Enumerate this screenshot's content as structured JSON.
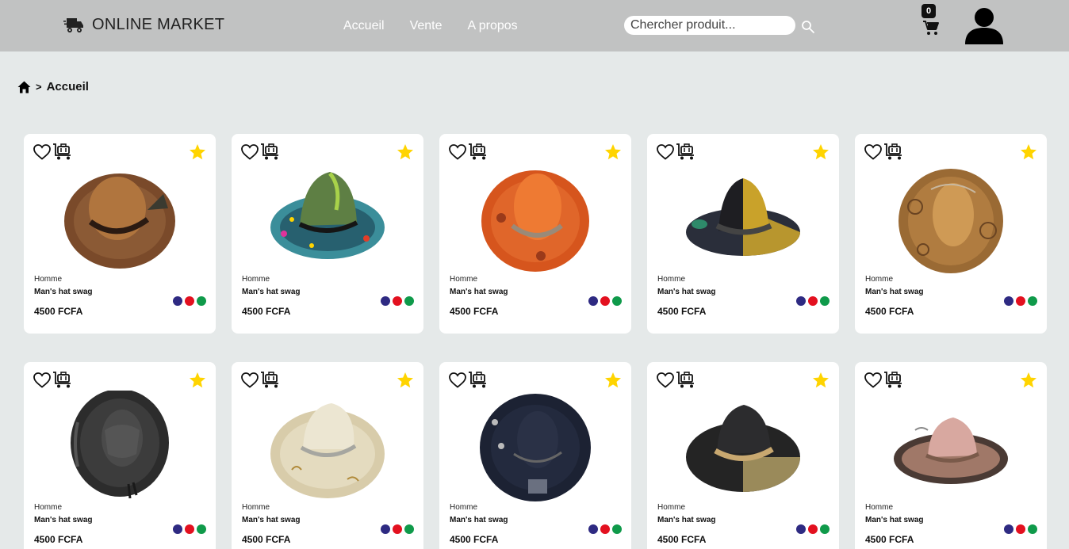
{
  "brand": {
    "name": "ONLINE MARKET",
    "icon": "truck-icon"
  },
  "nav": [
    {
      "label": "Accueil"
    },
    {
      "label": "Vente"
    },
    {
      "label": "A propos"
    }
  ],
  "search": {
    "placeholder": "Chercher produit...",
    "icon": "search-icon"
  },
  "cart": {
    "count": "0",
    "icon": "cart-icon"
  },
  "user": {
    "icon": "user-avatar-icon"
  },
  "breadcrumb": {
    "separator": ">",
    "current": "Accueil",
    "icon": "home-icon"
  },
  "colors": {
    "accent_star": "#ffd400",
    "swatch_1": "#2e2a82",
    "swatch_2": "#e3101f",
    "swatch_3": "#0f9a4a"
  },
  "products": [
    {
      "category": "Homme",
      "name": "Man's hat swag",
      "price": "4500 FCFA",
      "image": "brown-hat"
    },
    {
      "category": "Homme",
      "name": "Man's hat swag",
      "price": "4500 FCFA",
      "image": "painted-hat"
    },
    {
      "category": "Homme",
      "name": "Man's hat swag",
      "price": "4500 FCFA",
      "image": "orange-hat"
    },
    {
      "category": "Homme",
      "name": "Man's hat swag",
      "price": "4500 FCFA",
      "image": "black-yellow-hat"
    },
    {
      "category": "Homme",
      "name": "Man's hat swag",
      "price": "4500 FCFA",
      "image": "tan-flower-hat"
    },
    {
      "category": "Homme",
      "name": "Man's hat swag",
      "price": "4500 FCFA",
      "image": "black-gucci-hat"
    },
    {
      "category": "Homme",
      "name": "Man's hat swag",
      "price": "4500 FCFA",
      "image": "cream-hat"
    },
    {
      "category": "Homme",
      "name": "Man's hat swag",
      "price": "4500 FCFA",
      "image": "navy-patch-hat"
    },
    {
      "category": "Homme",
      "name": "Man's hat swag",
      "price": "4500 FCFA",
      "image": "black-gold-hat"
    },
    {
      "category": "Homme",
      "name": "Man's hat swag",
      "price": "4500 FCFA",
      "image": "pink-hat"
    }
  ]
}
